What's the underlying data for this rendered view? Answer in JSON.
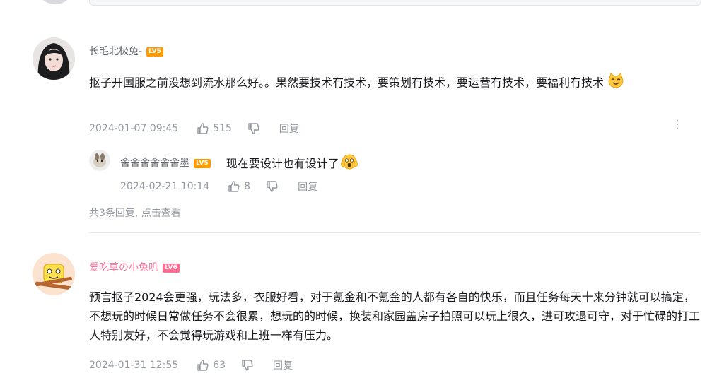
{
  "comments": [
    {
      "username": "长毛北极兔-",
      "level": "LV5",
      "text": "抠子开国服之前没想到流水那么好。。果然要技术有技术，要策划有技术，要运营有技术，要福利有技术",
      "emoji": "cat-smile-emoji",
      "date": "2024-01-07 09:45",
      "likes": "515",
      "reply_label": "回复",
      "more_icon": "⋮",
      "replies": [
        {
          "username": "舍舍舍舍舍舍墨",
          "level": "LV5",
          "text": "现在要设计也有设计了",
          "emoji": "scared-face-emoji",
          "date": "2024-02-21 10:14",
          "likes": "8",
          "reply_label": "回复"
        }
      ],
      "reply_summary_prefix": "共3条回复, ",
      "reply_summary_link": "点击查看"
    },
    {
      "username": "爱吃草の小兔叽",
      "level": "LV6",
      "text": "预言抠子2024会更强，玩法多，衣服好看，对于氪金和不氪金的人都有各自的快乐，而且任务每天十来分钟就可以搞定，不想玩的时候日常做任务不会很累，想玩的的时候，换装和家园盖房子拍照可以玩上很久，进可攻退可守，对于忙碌的打工人特别友好，不会觉得玩游戏和上班一样有压力。",
      "date": "2024-01-31 12:55",
      "likes": "63",
      "reply_label": "回复"
    }
  ],
  "colors": {
    "meta": "#9499a0",
    "username": "#61666d",
    "vip_username": "#fb7299",
    "lv5": "#ff9900",
    "lv6": "#ff6c92",
    "divider": "#e3e5e7"
  }
}
